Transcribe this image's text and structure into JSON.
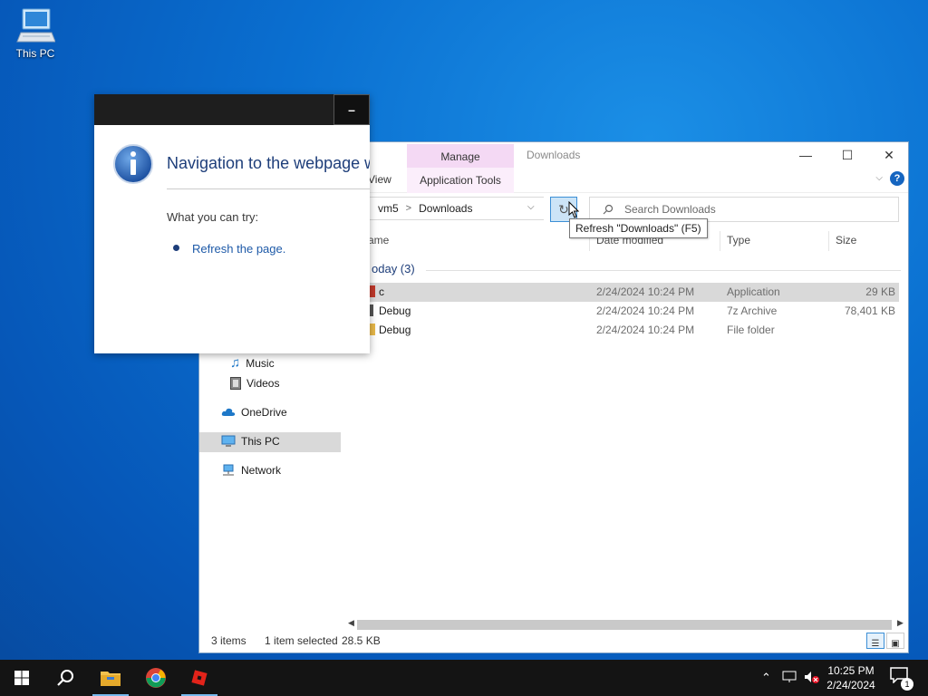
{
  "desktop": {
    "icons": [
      {
        "label": "This PC"
      }
    ]
  },
  "dialog": {
    "minimize_label": "–",
    "heading": "Navigation to the webpage w",
    "subheading": "What you can try:",
    "link": "Refresh the page."
  },
  "explorer": {
    "title": "Downloads",
    "contextual_tab": "Manage",
    "contextual_group": "Application Tools",
    "ribbon_tab_view": "View",
    "window_controls": {
      "minimize": "—",
      "maximize": "☐",
      "close": "✕"
    },
    "help_label": "?",
    "address": {
      "segment1": "vm5",
      "separator": ">",
      "segment2": "Downloads"
    },
    "refresh_glyph": "↻",
    "search_placeholder": "Search Downloads",
    "columns": {
      "name": "ame",
      "date": "Date modified",
      "type": "Type",
      "size": "Size"
    },
    "group_label": "oday (3)",
    "files": [
      {
        "name": "c",
        "date": "2/24/2024 10:24 PM",
        "type": "Application",
        "size": "29 KB",
        "icon_color": "#c0392b",
        "selected": true
      },
      {
        "name": "Debug",
        "date": "2/24/2024 10:24 PM",
        "type": "7z Archive",
        "size": "78,401 KB",
        "icon_color": "#555555",
        "selected": false
      },
      {
        "name": "Debug",
        "date": "2/24/2024 10:24 PM",
        "type": "File folder",
        "size": "",
        "icon_color": "#e8b84a",
        "selected": false
      }
    ],
    "nav": {
      "music": "Music",
      "videos": "Videos",
      "onedrive": "OneDrive",
      "this_pc": "This PC",
      "network": "Network"
    },
    "status": {
      "items": "3 items",
      "selected": "1 item selected",
      "size": "28.5 KB"
    },
    "tooltip": "Refresh \"Downloads\" (F5)"
  },
  "taskbar": {
    "clock_time": "10:25 PM",
    "clock_date": "2/24/2024",
    "notification_count": "1"
  },
  "colors": {
    "accent": "#0078d7",
    "selection": "#d9d9d9",
    "manage_tab": "#f4d9f4"
  }
}
